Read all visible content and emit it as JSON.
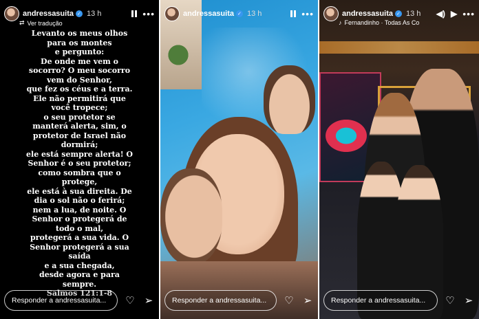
{
  "panel1": {
    "username": "andressasuita",
    "time": "13 h",
    "translate_label": "Ver tradução",
    "text": "Levanto os meus olhos\npara os montes\ne pergunto:\nDe onde me vem o\nsocorro? O meu socorro\nvem do Senhor,\nque fez os céus e a terra.\nEle não permitirá que\nvocê tropece;\no seu protetor se\nmanterá alerta, sim, o\nprotetor de Israel não\ndormirá;\nele está sempre alerta! O\nSenhor é o seu protetor;\ncomo sombra que o\nprotege,\nele está à sua direita. De\ndia o sol não o ferirá;\nnem a lua, de noite. O\nSenhor o protegerá de\ntodo o mal,\nprotegerá a sua vida. O\nSenhor protegerá a sua\nsaída\ne a sua chegada,\ndesde agora e para\nsempre.\nSalmos 121:1-8",
    "reply_placeholder": "Responder a andressasuita..."
  },
  "panel2": {
    "username": "andressasuita",
    "time": "13 h",
    "reply_placeholder": "Responder a andressasuita..."
  },
  "panel3": {
    "username": "andressasuita",
    "time": "13 h",
    "music": "Fernandinho · Todas As Co",
    "reply_placeholder": "Responder a andressasuita..."
  },
  "icons": {
    "pause": "pause-icon",
    "more": "more-icon",
    "heart": "heart-icon",
    "send": "send-icon",
    "volume": "volume-icon",
    "play": "play-icon",
    "translate": "translate-icon",
    "music": "music-icon"
  },
  "colors": {
    "verified": "#3897f0",
    "panel1_bg": "#000000"
  }
}
